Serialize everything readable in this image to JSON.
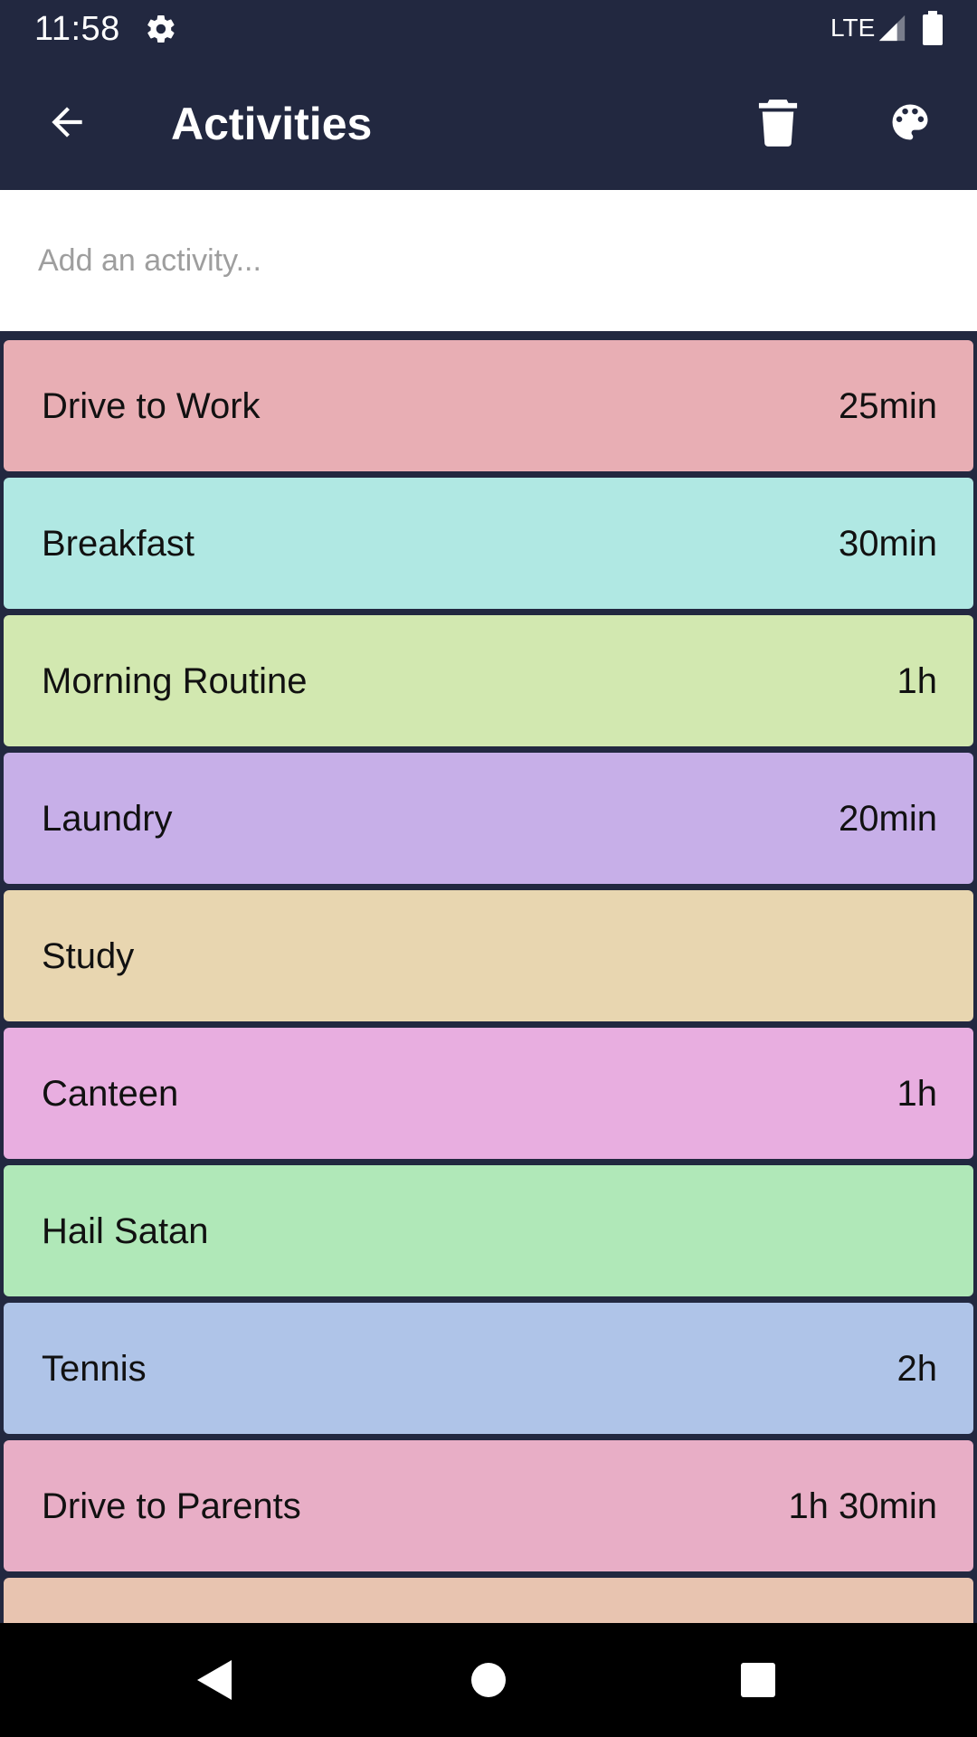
{
  "status_bar": {
    "time": "11:58",
    "network": "LTE",
    "icons": [
      "gear-icon",
      "signal-icon",
      "battery-icon"
    ]
  },
  "app_bar": {
    "title": "Activities",
    "icons": [
      "back-arrow-icon",
      "trash-icon",
      "palette-icon"
    ]
  },
  "add_activity": {
    "placeholder": "Add an activity...",
    "value": ""
  },
  "activities": [
    {
      "name": "Drive to Work",
      "duration": "25min",
      "color": "#e8aeb4"
    },
    {
      "name": "Breakfast",
      "duration": "30min",
      "color": "#b0e8e3"
    },
    {
      "name": "Morning Routine",
      "duration": "1h",
      "color": "#d2e8b0"
    },
    {
      "name": "Laundry",
      "duration": "20min",
      "color": "#c7afe8"
    },
    {
      "name": "Study",
      "duration": "",
      "color": "#e8d6b0"
    },
    {
      "name": "Canteen",
      "duration": "1h",
      "color": "#e8aee0"
    },
    {
      "name": "Hail Satan",
      "duration": "",
      "color": "#b0e8b8"
    },
    {
      "name": "Tennis",
      "duration": "2h",
      "color": "#afc4e8"
    },
    {
      "name": "Drive to Parents",
      "duration": "1h 30min",
      "color": "#e8aec6"
    },
    {
      "name": "",
      "duration": "",
      "color": "#e8c4b0"
    }
  ],
  "nav_bar": {
    "icons": [
      "nav-back-icon",
      "nav-home-icon",
      "nav-recent-icon"
    ]
  },
  "colors": {
    "app_bar": "#222840",
    "list_background": "#222840",
    "nav_bar": "#000000"
  }
}
